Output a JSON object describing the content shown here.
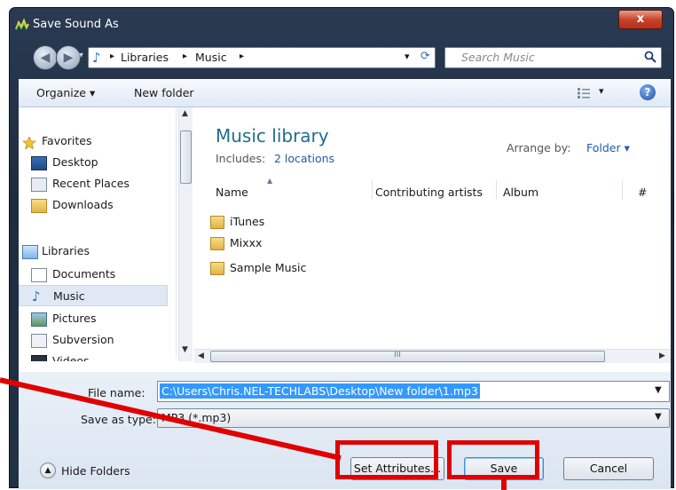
{
  "window": {
    "title": "Save Sound As",
    "close_glyph": "x"
  },
  "address": {
    "crumbs": [
      "Libraries",
      "Music"
    ],
    "sep": "▸",
    "dropdown": "▾",
    "refresh": "⟳"
  },
  "search": {
    "placeholder": "Search Music"
  },
  "toolbar": {
    "organize": "Organize ▾",
    "new_folder": "New folder",
    "views": "▾",
    "help": "?"
  },
  "nav": {
    "favorites": "Favorites",
    "items": [
      "Desktop",
      "Recent Places",
      "Downloads"
    ],
    "libraries": "Libraries",
    "lib_items": [
      "Documents",
      "Music",
      "Pictures",
      "Subversion",
      "Videos"
    ]
  },
  "library": {
    "title": "Music library",
    "includes_label": "Includes:",
    "includes_link": "2 locations",
    "arrange_label": "Arrange by:",
    "arrange_value": "Folder ▾"
  },
  "columns": [
    "Name",
    "Contributing artists",
    "Album",
    "#"
  ],
  "files": [
    "iTunes",
    "Mixxx",
    "Sample Music"
  ],
  "hscroll_grip": "III",
  "form": {
    "file_name_label": "File name:",
    "file_name_value": "C:\\Users\\Chris.NEL-TECHLABS\\Desktop\\New folder\\1.mp3",
    "save_type_label": "Save as type:",
    "save_type_value": "MP3 (*.mp3)"
  },
  "footer": {
    "hide_folders": "Hide Folders",
    "set_attributes": "Set Attributes...",
    "save": "Save",
    "cancel": "Cancel"
  },
  "colors": {
    "highlight": "#e00000",
    "link": "#1e5aa8",
    "library_title": "#1e6e8e",
    "selection": "#3399ff"
  }
}
